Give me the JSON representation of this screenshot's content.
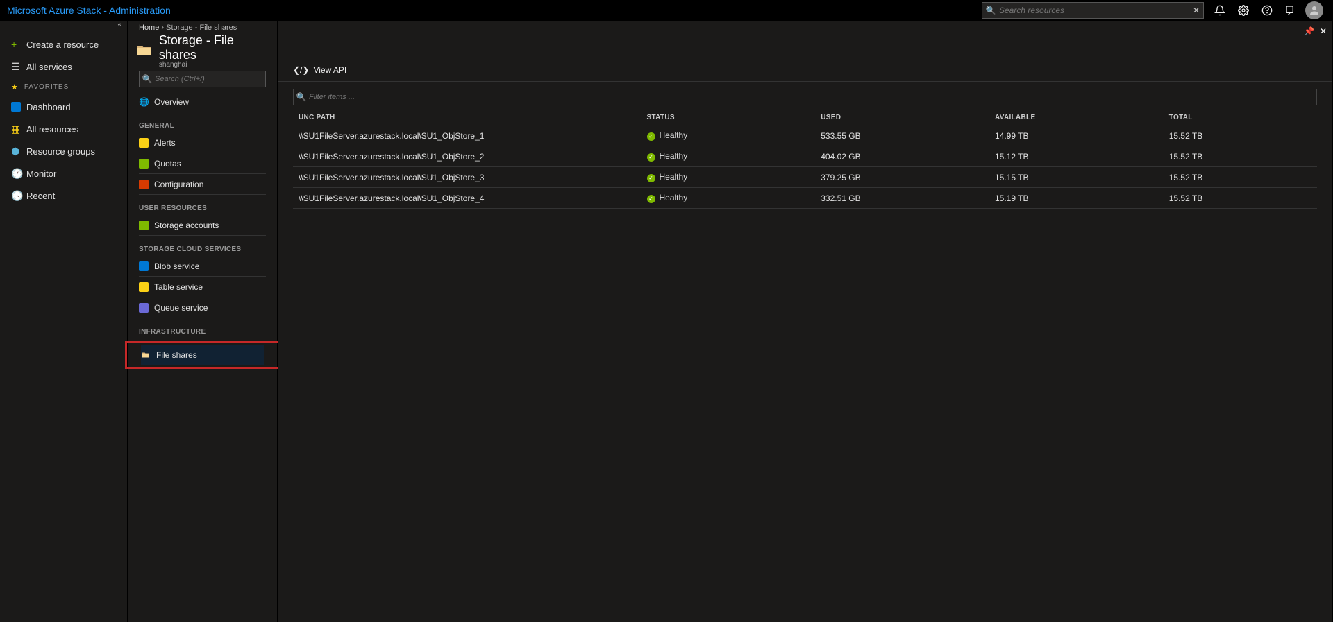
{
  "app_title": "Microsoft Azure Stack - Administration",
  "search_placeholder": "Search resources",
  "leftnav": {
    "create": "Create a resource",
    "all_services": "All services",
    "favorites_label": "FAVORITES",
    "items": [
      "Dashboard",
      "All resources",
      "Resource groups",
      "Monitor",
      "Recent"
    ]
  },
  "breadcrumb": {
    "home": "Home",
    "sep": "›",
    "current": "Storage - File shares"
  },
  "blade": {
    "title": "Storage - File shares",
    "subtitle": "shanghai",
    "menu_search_placeholder": "Search (Ctrl+/)",
    "sections": [
      {
        "items": [
          {
            "label": "Overview",
            "icon": "globe"
          }
        ]
      },
      {
        "header": "GENERAL",
        "items": [
          {
            "label": "Alerts",
            "icon": "alert"
          },
          {
            "label": "Quotas",
            "icon": "quota"
          },
          {
            "label": "Configuration",
            "icon": "config"
          }
        ]
      },
      {
        "header": "USER RESOURCES",
        "items": [
          {
            "label": "Storage accounts",
            "icon": "storage"
          }
        ]
      },
      {
        "header": "STORAGE CLOUD SERVICES",
        "items": [
          {
            "label": "Blob service",
            "icon": "blob"
          },
          {
            "label": "Table service",
            "icon": "table"
          },
          {
            "label": "Queue service",
            "icon": "queue"
          }
        ]
      },
      {
        "header": "INFRASTRUCTURE",
        "items": [
          {
            "label": "File shares",
            "icon": "folder",
            "active": true,
            "highlighted": true
          }
        ]
      }
    ]
  },
  "toolbar": {
    "view_api": "View API"
  },
  "filter_placeholder": "Filter items ...",
  "table": {
    "columns": [
      "UNC PATH",
      "STATUS",
      "USED",
      "AVAILABLE",
      "TOTAL"
    ],
    "rows": [
      {
        "path": "\\\\SU1FileServer.azurestack.local\\SU1_ObjStore_1",
        "status": "Healthy",
        "used": "533.55 GB",
        "available": "14.99 TB",
        "total": "15.52 TB"
      },
      {
        "path": "\\\\SU1FileServer.azurestack.local\\SU1_ObjStore_2",
        "status": "Healthy",
        "used": "404.02 GB",
        "available": "15.12 TB",
        "total": "15.52 TB"
      },
      {
        "path": "\\\\SU1FileServer.azurestack.local\\SU1_ObjStore_3",
        "status": "Healthy",
        "used": "379.25 GB",
        "available": "15.15 TB",
        "total": "15.52 TB"
      },
      {
        "path": "\\\\SU1FileServer.azurestack.local\\SU1_ObjStore_4",
        "status": "Healthy",
        "used": "332.51 GB",
        "available": "15.19 TB",
        "total": "15.52 TB"
      }
    ]
  }
}
